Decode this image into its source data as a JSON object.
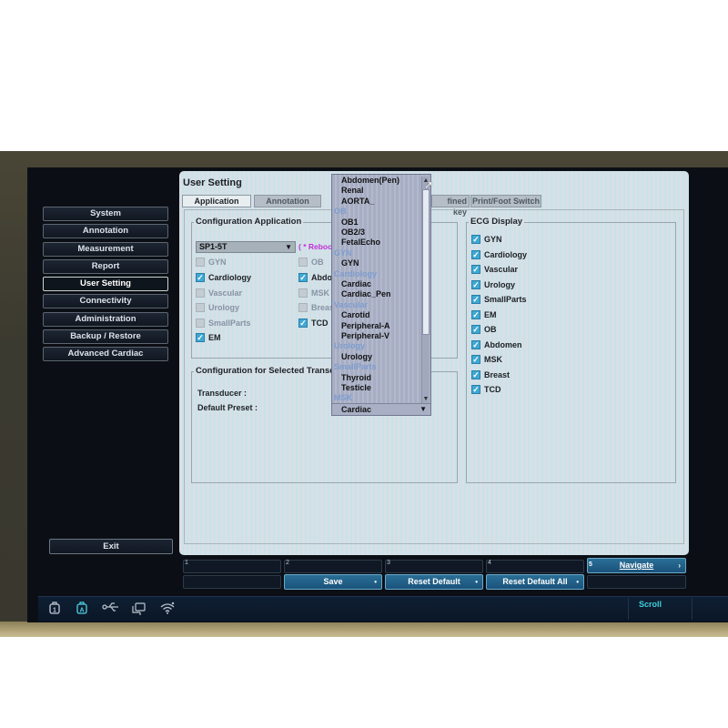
{
  "dialog": {
    "title": "User Setting",
    "tabs": [
      {
        "label": "Application",
        "active": true
      },
      {
        "label": "Annotation",
        "active": false
      },
      {
        "label": "fined key",
        "active": false
      },
      {
        "label": "Print/Foot Switch",
        "active": false
      }
    ]
  },
  "sidebar": {
    "items": [
      {
        "label": "System"
      },
      {
        "label": "Annotation"
      },
      {
        "label": "Measurement"
      },
      {
        "label": "Report"
      },
      {
        "label": "User Setting",
        "active": true
      },
      {
        "label": "Connectivity"
      },
      {
        "label": "Administration"
      },
      {
        "label": "Backup / Restore"
      },
      {
        "label": "Advanced Cardiac"
      }
    ],
    "exit_label": "Exit"
  },
  "config_app": {
    "title": "Configuration Application",
    "transducer_select": "SP1-5T",
    "reboot_note": "( * Reboo",
    "checkboxes_left": [
      {
        "label": "GYN",
        "checked": false,
        "enabled": false
      },
      {
        "label": "Cardiology",
        "checked": true,
        "enabled": true
      },
      {
        "label": "Vascular",
        "checked": false,
        "enabled": false
      },
      {
        "label": "Urology",
        "checked": false,
        "enabled": false
      },
      {
        "label": "SmallParts",
        "checked": false,
        "enabled": false
      },
      {
        "label": "EM",
        "checked": true,
        "enabled": true
      }
    ],
    "checkboxes_right": [
      {
        "label": "OB",
        "checked": false,
        "enabled": false
      },
      {
        "label": "Abdo",
        "checked": true,
        "enabled": true
      },
      {
        "label": "MSK",
        "checked": false,
        "enabled": false
      },
      {
        "label": "Breas",
        "checked": false,
        "enabled": false
      },
      {
        "label": "TCD",
        "checked": true,
        "enabled": true
      }
    ]
  },
  "config_transducer": {
    "title": "Configuration for Selected Transdu",
    "transducer_label": "Transducer :",
    "default_preset_label": "Default Preset :"
  },
  "ecg_display": {
    "title": "ECG Display",
    "items": [
      {
        "label": "GYN",
        "checked": true
      },
      {
        "label": "Cardiology",
        "checked": true
      },
      {
        "label": "Vascular",
        "checked": true
      },
      {
        "label": "Urology",
        "checked": true
      },
      {
        "label": "SmallParts",
        "checked": true
      },
      {
        "label": "EM",
        "checked": true
      },
      {
        "label": "OB",
        "checked": true
      },
      {
        "label": "Abdomen",
        "checked": true
      },
      {
        "label": "MSK",
        "checked": true
      },
      {
        "label": "Breast",
        "checked": true
      },
      {
        "label": "TCD",
        "checked": true
      }
    ]
  },
  "preset_dropdown": {
    "items": [
      {
        "label": "Abdomen(Pen)",
        "type": "option"
      },
      {
        "label": "Renal",
        "type": "option"
      },
      {
        "label": "AORTA_",
        "type": "option"
      },
      {
        "label": "OB",
        "type": "group"
      },
      {
        "label": "OB1",
        "type": "option"
      },
      {
        "label": "OB2/3",
        "type": "option"
      },
      {
        "label": "FetalEcho",
        "type": "option"
      },
      {
        "label": "GYN",
        "type": "group"
      },
      {
        "label": "GYN",
        "type": "option"
      },
      {
        "label": "Cardiology",
        "type": "group"
      },
      {
        "label": "Cardiac",
        "type": "option"
      },
      {
        "label": "Cardiac_Pen",
        "type": "option"
      },
      {
        "label": "Vascular",
        "type": "group"
      },
      {
        "label": "Carotid",
        "type": "option"
      },
      {
        "label": "Peripheral-A",
        "type": "option"
      },
      {
        "label": "Peripheral-V",
        "type": "option"
      },
      {
        "label": "Urology",
        "type": "group"
      },
      {
        "label": "Urology",
        "type": "option"
      },
      {
        "label": "SmallParts",
        "type": "group"
      },
      {
        "label": "Thyroid",
        "type": "option"
      },
      {
        "label": "Testicle",
        "type": "option"
      },
      {
        "label": "MSK",
        "type": "group"
      }
    ],
    "selected": "Cardiac",
    "scroll_up": "▲",
    "scroll_down": "▼"
  },
  "softkeys": {
    "numbers": [
      "1",
      "2",
      "3",
      "4",
      "5"
    ],
    "navigate_label": "Navigate",
    "save_label": "Save",
    "reset_default_label": "Reset Default",
    "reset_default_all_label": "Reset Default All"
  },
  "statusbar": {
    "icons": [
      "probe-1-icon",
      "a-mode-icon",
      "usb-icon",
      "network-icon",
      "wifi-icon"
    ],
    "probe_number": "1",
    "a_label": "A",
    "scroll_label": "Scroll"
  }
}
